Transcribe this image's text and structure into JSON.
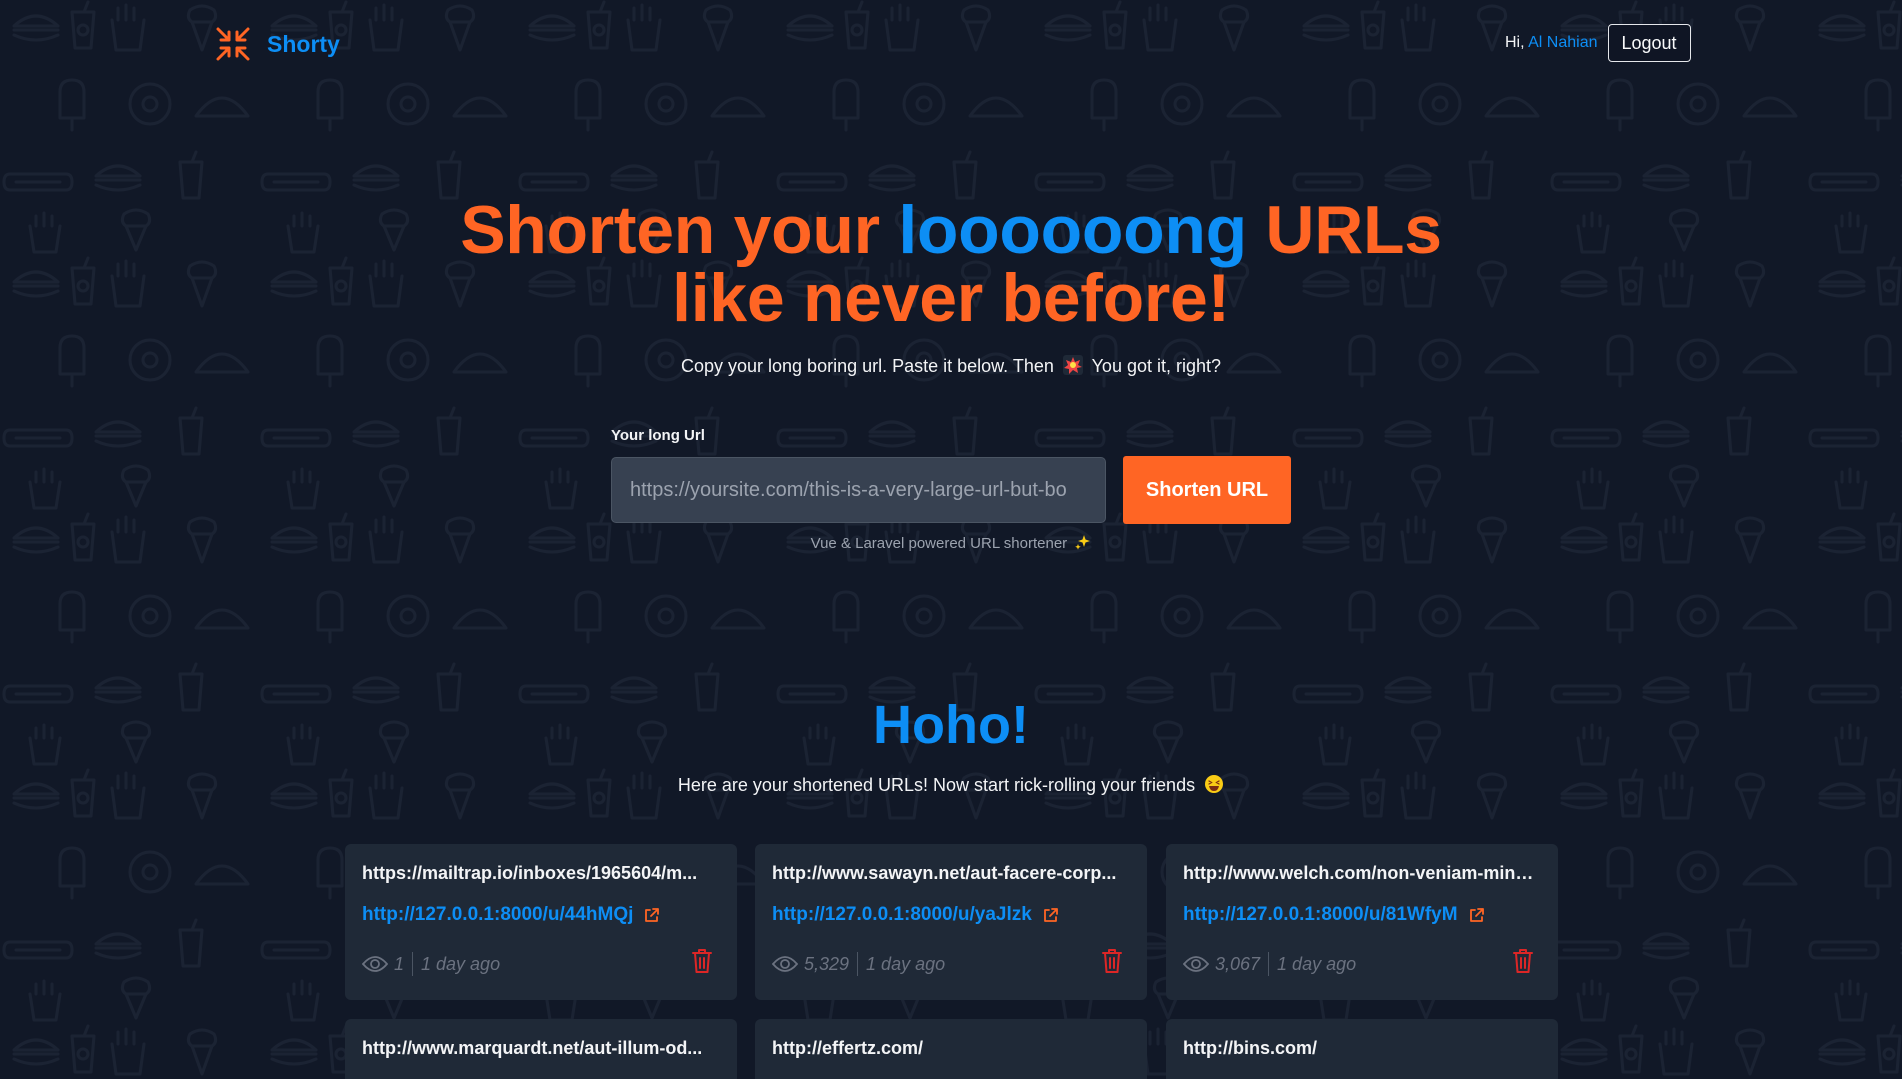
{
  "header": {
    "brand": "Shorty",
    "greeting": "Hi,",
    "user_name": "Al Nahian",
    "logout_label": "Logout"
  },
  "hero": {
    "title_part1": "Shorten your ",
    "title_highlight": "loooooong",
    "title_part2": " URLs",
    "title_line2": "like never before!",
    "subtitle_before": "Copy your long boring url. Paste it below. Then",
    "subtitle_after": "You got it, right?"
  },
  "form": {
    "label": "Your long Url",
    "placeholder": "https://yoursite.com/this-is-a-very-large-url-but-bo",
    "value": "",
    "submit_label": "Shorten URL",
    "powered_by": "Vue & Laravel powered URL shortener"
  },
  "section": {
    "title": "Hoho!",
    "subtitle": "Here are your shortened URLs! Now start rick-rolling your friends"
  },
  "links": [
    {
      "original": "https://mailtrap.io/inboxes/1965604/m...",
      "short": "http://127.0.0.1:8000/u/44hMQj",
      "views": "1",
      "created": "1 day ago"
    },
    {
      "original": "http://www.sawayn.net/aut-facere-corp...",
      "short": "http://127.0.0.1:8000/u/yaJlzk",
      "views": "5,329",
      "created": "1 day ago"
    },
    {
      "original": "http://www.welch.com/non-veniam-minus...",
      "short": "http://127.0.0.1:8000/u/81WfyM",
      "views": "3,067",
      "created": "1 day ago"
    },
    {
      "original": "http://www.marquardt.net/aut-illum-od..."
    },
    {
      "original": "http://effertz.com/"
    },
    {
      "original": "http://bins.com/"
    }
  ],
  "colors": {
    "background": "#111827",
    "accent_orange": "#ff6524",
    "accent_blue": "#0d8ef5",
    "card": "#1f2937",
    "danger": "#dc2626"
  }
}
